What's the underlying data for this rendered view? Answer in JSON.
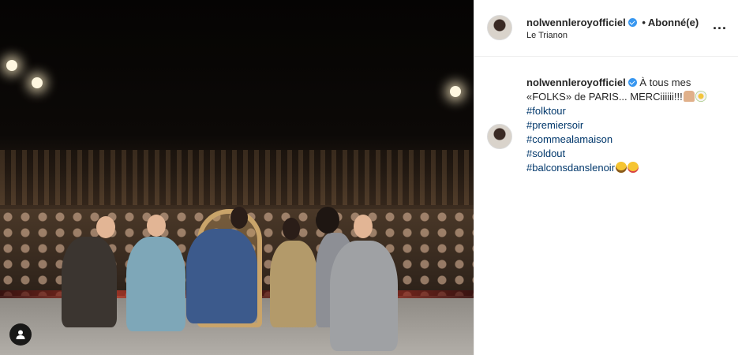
{
  "post": {
    "photo_alt": "",
    "colors": {
      "verified_badge": "#3897f0",
      "hashtag_link": "#00376b",
      "divider": "#efefef"
    }
  },
  "header": {
    "username": "nolwennleroyofficiel",
    "separator": "•",
    "follow_label": "Abonné(e)",
    "location": "Le Trianon",
    "more_label": "..."
  },
  "caption": {
    "username": "nolwennleroyofficiel",
    "text": "À tous mes «FOLKS» de PARIS... MERCiiiiii!!!",
    "hashtags": [
      "#folktour",
      "#premiersoir",
      "#commealamaison",
      "#soldout",
      "#balconsdanslenoir"
    ]
  },
  "icons": {
    "header_avatar": "avatar-icon",
    "verified": "verified-badge-icon",
    "more": "more-options-icon",
    "tagged_users": "tagged-users-icon",
    "emoji_1": "folded-hands-emoji",
    "emoji_2": "flower-emoji",
    "emoji_3": "grinning-face-emoji",
    "emoji_4": "yum-face-emoji"
  }
}
